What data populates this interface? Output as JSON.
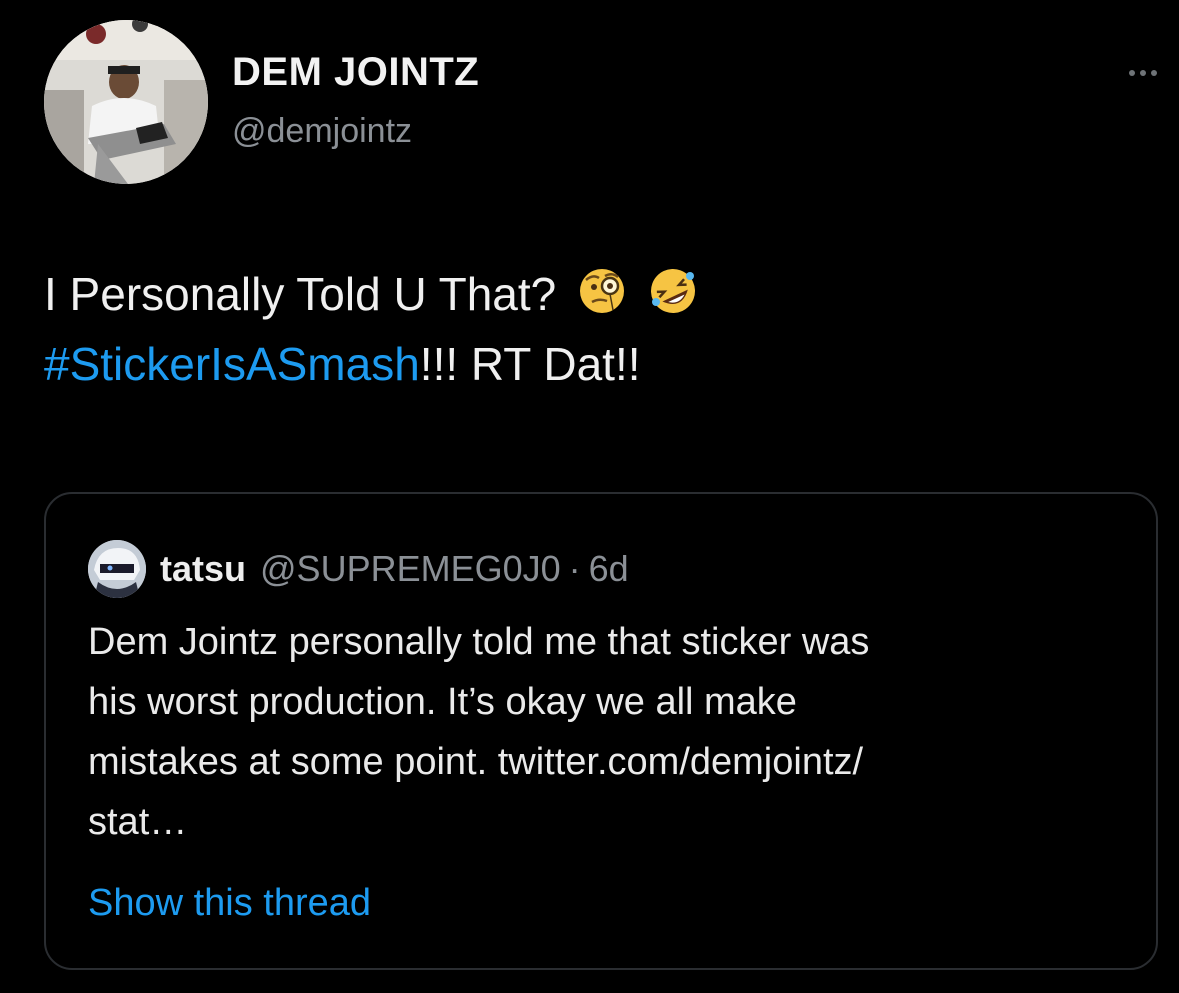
{
  "author": {
    "display_name": "DEM JOINTZ",
    "handle": "@demjointz",
    "avatar_icon": "profile-photo"
  },
  "more_icon": "more-horizontal-icon",
  "tweet": {
    "line1": "I Personally Told U That?",
    "emoji": [
      "face-with-monocle-icon",
      "rolling-on-floor-laughing-icon"
    ],
    "hashtag": "#StickerIsASmash",
    "line2_rest": "!!! RT Dat!!"
  },
  "quoted_tweet": {
    "name": "tatsu",
    "handle": "@SUPREMEG0J0",
    "separator": "·",
    "time": "6d",
    "lines": [
      "Dem Jointz personally told me that sticker was",
      "his worst production. It’s okay we all make",
      "mistakes at some point. twitter.com/demjointz/",
      "stat…"
    ],
    "show_thread_label": "Show this thread"
  },
  "colors": {
    "background": "#000000",
    "link": "#1d9bf0",
    "secondary_text": "#8b9096",
    "border": "#2a2d31"
  }
}
